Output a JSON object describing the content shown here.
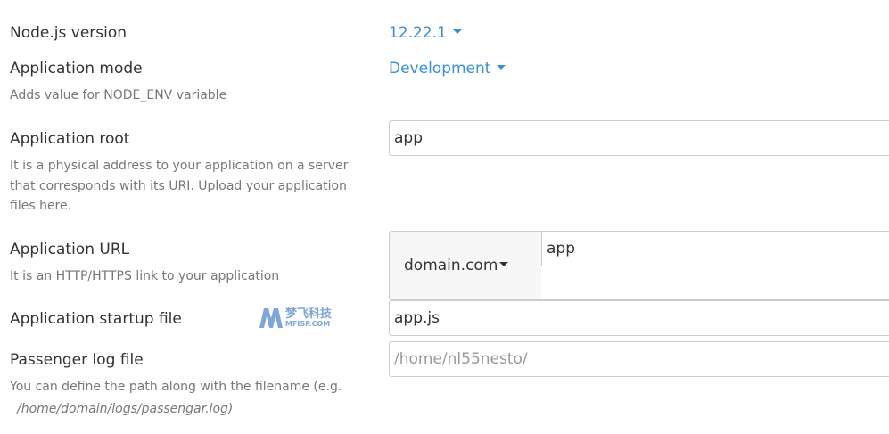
{
  "node_version": {
    "label": "Node.js version",
    "value": "12.22.1"
  },
  "app_mode": {
    "label": "Application mode",
    "value": "Development",
    "help": "Adds value for NODE_ENV variable"
  },
  "app_root": {
    "label": "Application root",
    "value": "app",
    "help": "It is a physical address to your application on a server that corresponds with its URI. Upload your application files here."
  },
  "app_url": {
    "label": "Application URL",
    "domain": "domain.com",
    "path": "app",
    "help": "It is an HTTP/HTTPS link to your application"
  },
  "startup_file": {
    "label": "Application startup file",
    "value": "app.js"
  },
  "log_file": {
    "label": "Passenger log file",
    "placeholder": "/home/nl55nesto/",
    "help_prefix": "You can define the path along with the filename (e.g.",
    "help_example": "/home/domain/logs/passengar.log)"
  },
  "watermark": {
    "text": "梦飞科技",
    "sub": "MFISP.COM"
  },
  "colors": {
    "link": "#3a8fd6",
    "help_text": "#777777",
    "border": "#cccccc"
  }
}
